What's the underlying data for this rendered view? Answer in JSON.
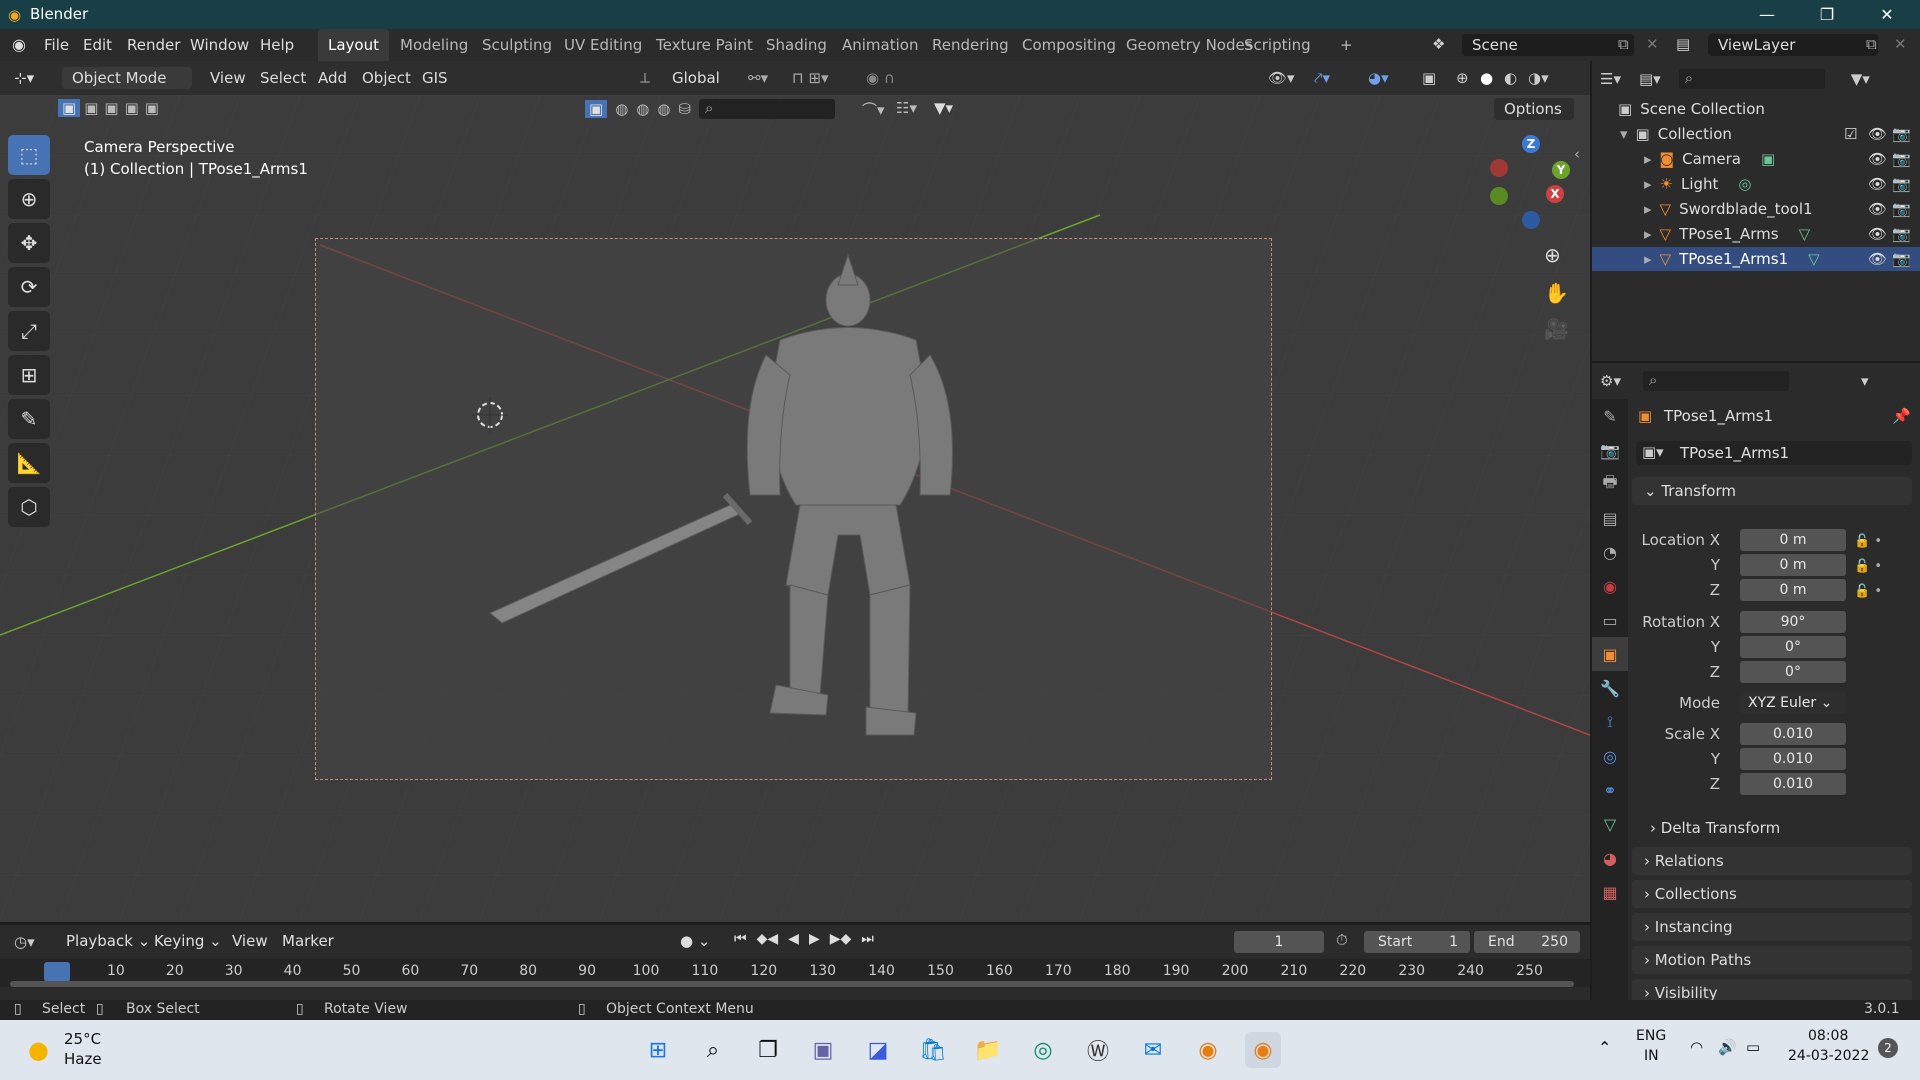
{
  "window": {
    "title": "Blender"
  },
  "menu": {
    "file": "File",
    "edit": "Edit",
    "render": "Render",
    "window": "Window",
    "help": "Help"
  },
  "workspaces": [
    "Layout",
    "Modeling",
    "Sculpting",
    "UV Editing",
    "Texture Paint",
    "Shading",
    "Animation",
    "Rendering",
    "Compositing",
    "Geometry Nodes",
    "Scripting"
  ],
  "scene": {
    "name": "Scene",
    "view_layer": "ViewLayer"
  },
  "viewport_header": {
    "mode": "Object Mode",
    "view": "View",
    "select": "Select",
    "add": "Add",
    "object": "Object",
    "gis": "GIS",
    "orientation": "Global",
    "options": "Options"
  },
  "viewport": {
    "perspective": "Camera Perspective",
    "context": "(1) Collection | TPose1_Arms1"
  },
  "outliner": {
    "root": "Scene Collection",
    "collection": "Collection",
    "items": [
      "Camera",
      "Light",
      "Swordblade_tool1",
      "TPose1_Arms",
      "TPose1_Arms1"
    ]
  },
  "properties": {
    "object_name": "TPose1_Arms1",
    "object_field": "TPose1_Arms1",
    "transform_label": "Transform",
    "location_x_label": "Location X",
    "location_x": "0 m",
    "location_y_label": "Y",
    "location_y": "0 m",
    "location_z_label": "Z",
    "location_z": "0 m",
    "rotation_x_label": "Rotation X",
    "rotation_x": "90°",
    "rotation_y_label": "Y",
    "rotation_y": "0°",
    "rotation_z_label": "Z",
    "rotation_z": "0°",
    "mode_label": "Mode",
    "mode": "XYZ Euler",
    "scale_x_label": "Scale X",
    "scale_x": "0.010",
    "scale_y_label": "Y",
    "scale_y": "0.010",
    "scale_z_label": "Z",
    "scale_z": "0.010",
    "delta_transform": "Delta Transform",
    "relations": "Relations",
    "collections": "Collections",
    "instancing": "Instancing",
    "motion_paths": "Motion Paths",
    "visibility": "Visibility"
  },
  "timeline": {
    "playback": "Playback",
    "keying": "Keying",
    "view": "View",
    "marker": "Marker",
    "current_frame": "1",
    "start_label": "Start",
    "start": "1",
    "end_label": "End",
    "end": "250",
    "ticks": [
      "1",
      "10",
      "20",
      "30",
      "40",
      "50",
      "60",
      "70",
      "80",
      "90",
      "100",
      "110",
      "120",
      "130",
      "140",
      "150",
      "160",
      "170",
      "180",
      "190",
      "200",
      "210",
      "220",
      "230",
      "240",
      "250"
    ]
  },
  "statusbar": {
    "select": "Select",
    "box_select": "Box Select",
    "rotate_view": "Rotate View",
    "context_menu": "Object Context Menu",
    "version": "3.0.1"
  },
  "taskbar": {
    "temp": "25°C",
    "weather": "Haze",
    "lang": "ENG",
    "region": "IN",
    "time": "08:08",
    "date": "24-03-2022",
    "notif": "2"
  },
  "colors": {
    "accent": "#4772b3",
    "titlebar": "#173f45",
    "x_axis": "#d04040",
    "y_axis": "#6ea32c",
    "z_axis": "#3d7ad6",
    "object_orange": "#f08e30"
  }
}
